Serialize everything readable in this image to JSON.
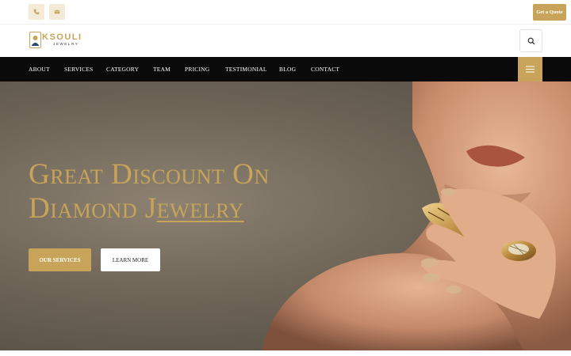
{
  "topbar": {
    "phone_icon": "phone-icon",
    "mail_icon": "mail-icon",
    "quote_label": "Get a Quote"
  },
  "header": {
    "logo_name": "KSOULI",
    "logo_tagline": "JEWELRY",
    "search_icon": "search-icon"
  },
  "nav": {
    "items": [
      {
        "label": "ABOUT"
      },
      {
        "label": "SERVICES"
      },
      {
        "label": "CATEGORY"
      },
      {
        "label": "TEAM"
      },
      {
        "label": "PRICING"
      },
      {
        "label": "TESTIMONIAL"
      },
      {
        "label": "BLOG"
      },
      {
        "label": "CONTACT"
      }
    ],
    "menu_icon": "hamburger-icon"
  },
  "hero": {
    "title_line1": "Great Discount On",
    "title_line2_plain": "Diamond J",
    "title_line2_underlined": "ewelry",
    "primary_button": "OUR SERVICES",
    "secondary_button": "LEARN MORE"
  },
  "colors": {
    "accent": "#c8a45a",
    "nav_bg": "#0a0a0a",
    "icon_bg": "#f3ead8"
  }
}
